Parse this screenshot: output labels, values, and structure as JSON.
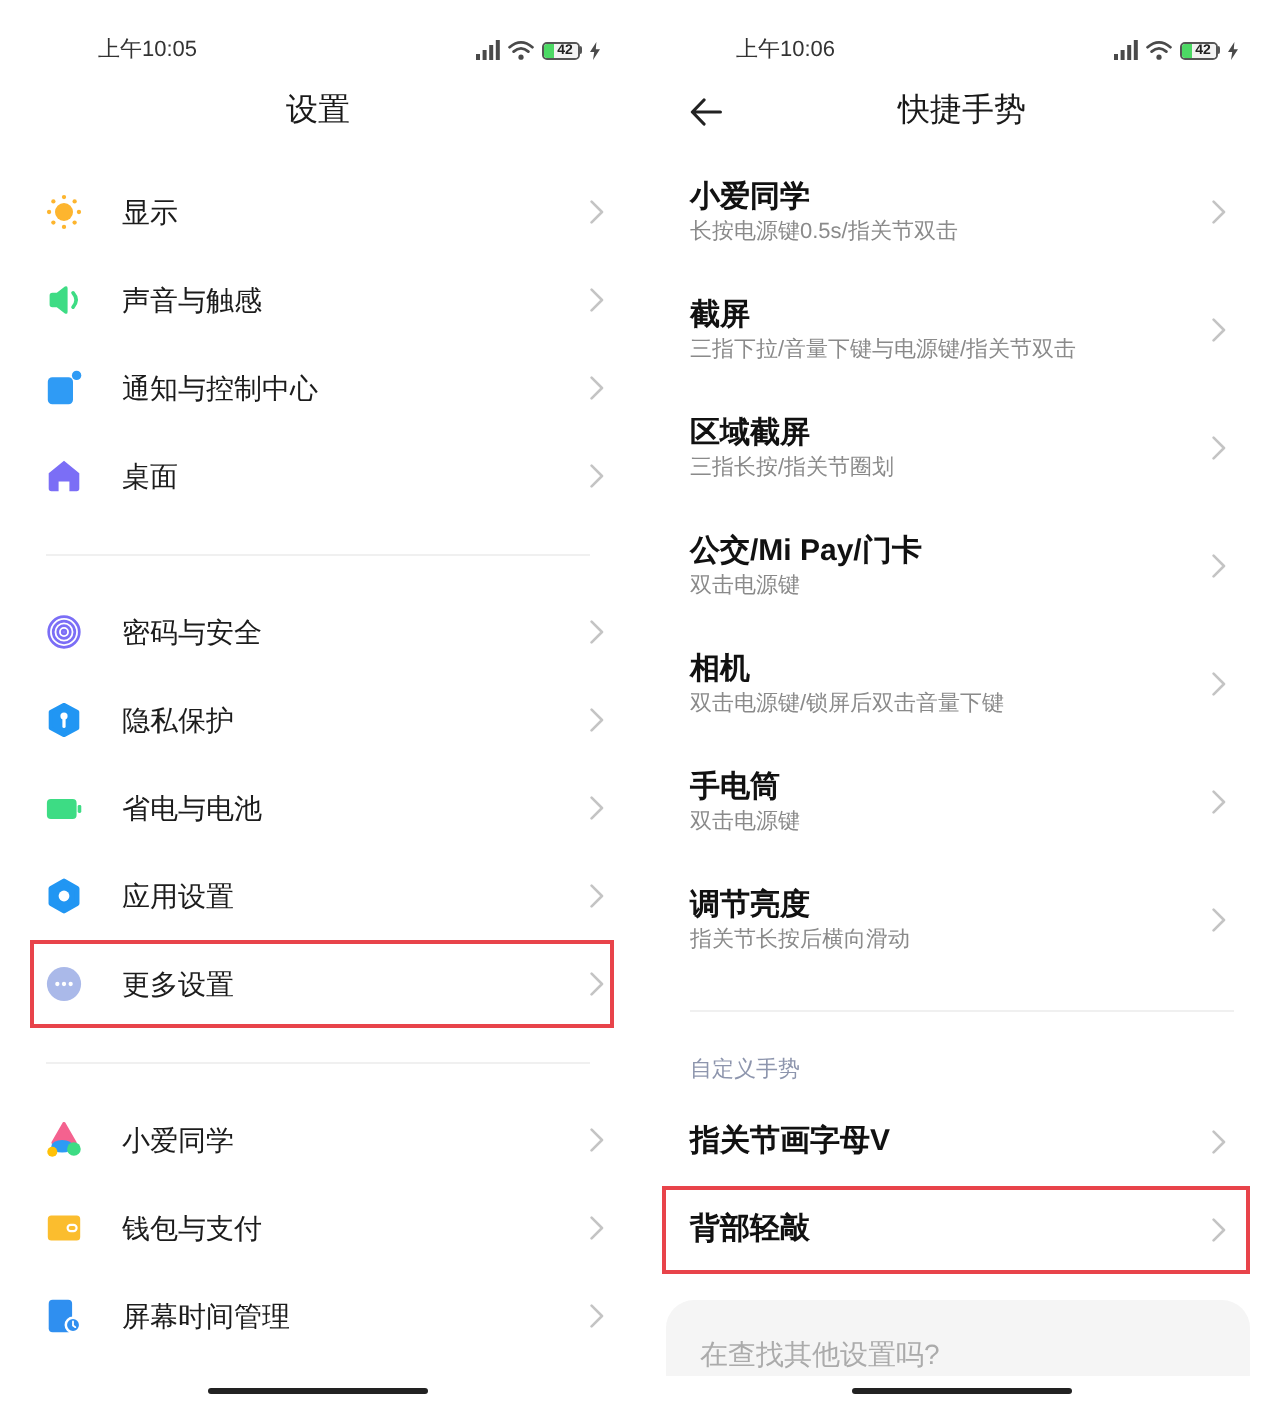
{
  "settings_screen": {
    "status_bar": {
      "time": "上午10:05",
      "battery": "42"
    },
    "title": "设置",
    "groups": [
      {
        "items": [
          {
            "label": "显示",
            "highlighted": false
          },
          {
            "label": "声音与触感",
            "highlighted": false
          },
          {
            "label": "通知与控制中心",
            "highlighted": false
          },
          {
            "label": "桌面",
            "highlighted": false
          }
        ]
      },
      {
        "items": [
          {
            "label": "密码与安全",
            "highlighted": false
          },
          {
            "label": "隐私保护",
            "highlighted": false
          },
          {
            "label": "省电与电池",
            "highlighted": false
          },
          {
            "label": "应用设置",
            "highlighted": false
          },
          {
            "label": "更多设置",
            "highlighted": true
          }
        ]
      },
      {
        "items": [
          {
            "label": "小爱同学",
            "highlighted": false
          },
          {
            "label": "钱包与支付",
            "highlighted": false
          },
          {
            "label": "屏幕时间管理",
            "highlighted": false
          }
        ]
      }
    ]
  },
  "gestures_screen": {
    "status_bar": {
      "time": "上午10:06",
      "battery": "42"
    },
    "title": "快捷手势",
    "items": [
      {
        "title": "小爱同学",
        "shortcut": "长按电源键0.5s/指关节双击",
        "highlighted": false
      },
      {
        "title": "截屏",
        "shortcut": "三指下拉/音量下键与电源键/指关节双击",
        "highlighted": false
      },
      {
        "title": "区域截屏",
        "shortcut": "三指长按/指关节圈划",
        "highlighted": false
      },
      {
        "title": "公交/Mi Pay/门卡",
        "shortcut": "双击电源键",
        "highlighted": false
      },
      {
        "title": "相机",
        "shortcut": "双击电源键/锁屏后双击音量下键",
        "highlighted": false
      },
      {
        "title": "手电筒",
        "shortcut": "双击电源键",
        "highlighted": false
      },
      {
        "title": "调节亮度",
        "shortcut": "指关节长按后横向滑动",
        "highlighted": false
      }
    ],
    "section_header": "自定义手势",
    "custom_items": [
      {
        "title": "指关节画字母V",
        "highlighted": false
      },
      {
        "title": "背部轻敲",
        "highlighted": true
      }
    ],
    "search_prompt": "在查找其他设置吗?"
  }
}
